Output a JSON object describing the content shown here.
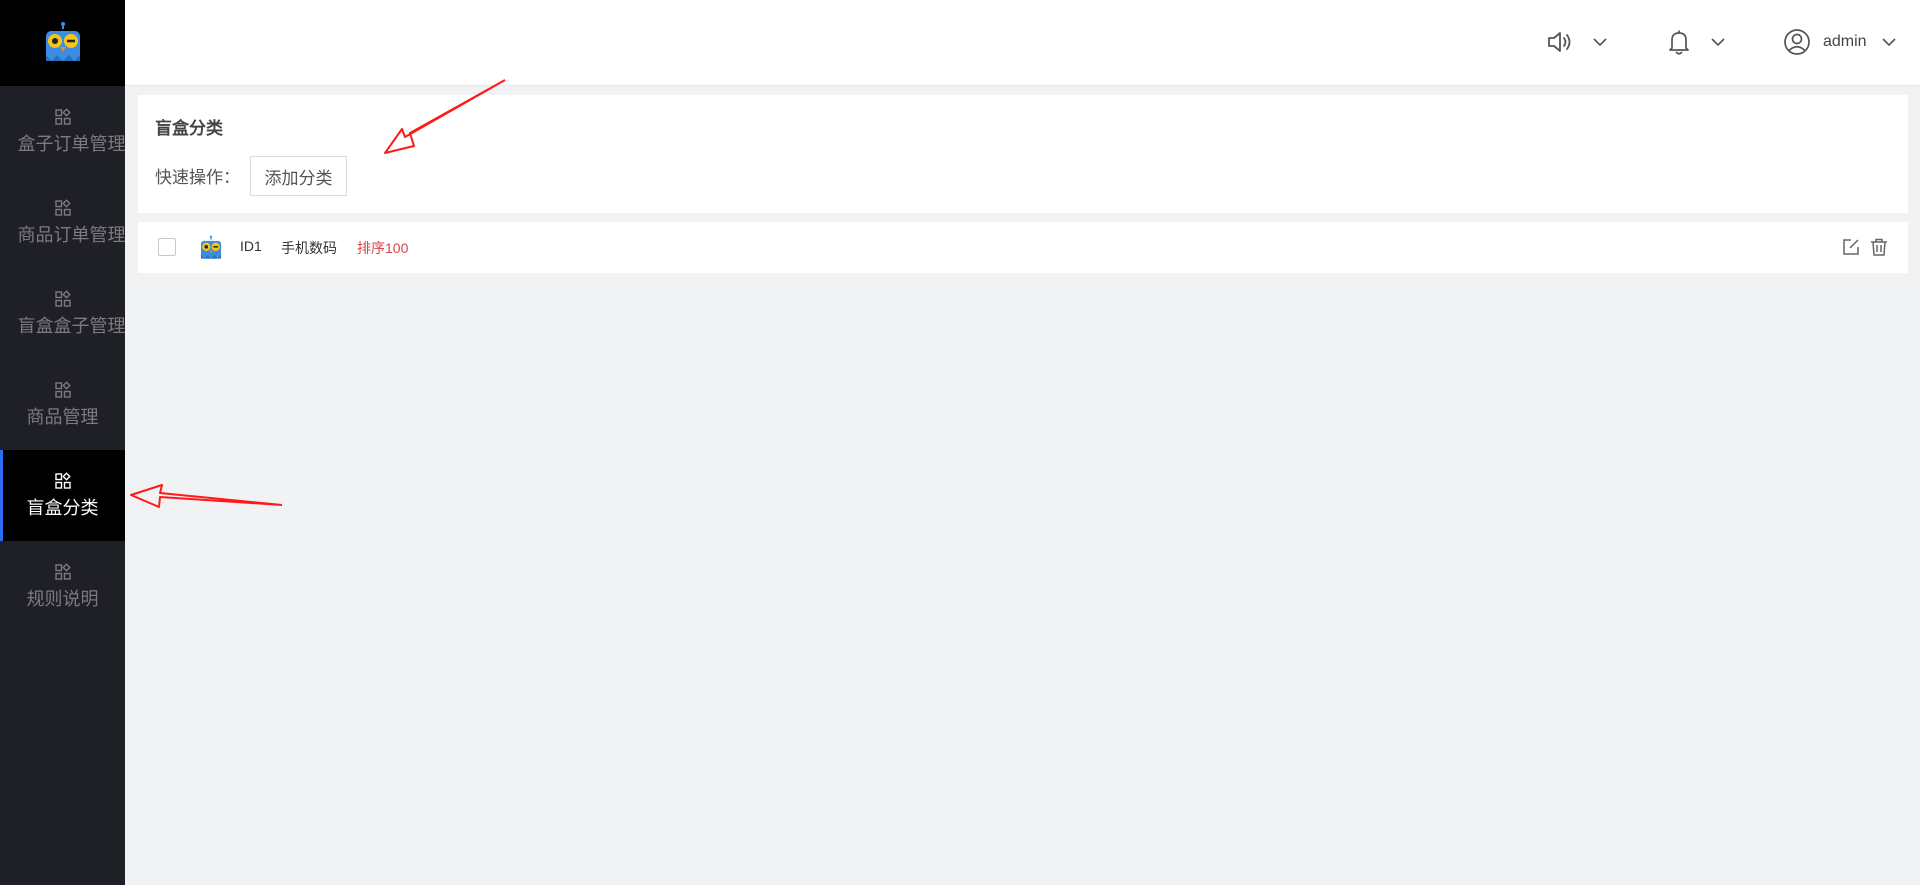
{
  "sidebar": {
    "logo_icon": "owl-logo-icon",
    "items": [
      {
        "label": "盒子订单管理",
        "icon": "grid-icon",
        "active": false
      },
      {
        "label": "商品订单管理",
        "icon": "grid-icon",
        "active": false
      },
      {
        "label": "盲盒盒子管理",
        "icon": "grid-icon",
        "active": false
      },
      {
        "label": "商品管理",
        "icon": "grid-icon",
        "active": false
      },
      {
        "label": "盲盒分类",
        "icon": "grid-icon",
        "active": true
      },
      {
        "label": "规则说明",
        "icon": "grid-icon",
        "active": false
      }
    ]
  },
  "header": {
    "icons": [
      "speaker-icon",
      "bell-icon",
      "user-icon"
    ],
    "user_name": "admin"
  },
  "panel": {
    "title": "盲盒分类",
    "quick_label": "快速操作：",
    "add_button": "添加分类"
  },
  "rows": [
    {
      "id": "ID1",
      "name": "手机数码",
      "sort": "排序100"
    }
  ],
  "colors": {
    "sidebar_bg": "#1f1f26",
    "active_bg": "#000000",
    "active_accent": "#2d6cf5",
    "sort_text": "#d64545",
    "annotation_arrow": "#ff0000"
  }
}
